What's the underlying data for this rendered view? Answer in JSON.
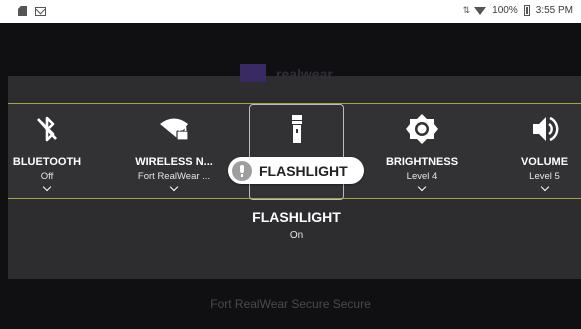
{
  "status_bar": {
    "battery_percent": "100%",
    "time": "3:55 PM",
    "left_icons": [
      "sd-card-icon",
      "mail-icon"
    ],
    "right_icons": [
      "data-arrows-icon",
      "wifi-icon",
      "battery-icon"
    ]
  },
  "background": {
    "logo_text": "realwear",
    "footer_text": "Fort RealWear Secure Secure"
  },
  "quick_settings": {
    "tiles": [
      {
        "icon": "bluetooth-off-icon",
        "label": "BLUETOOTH",
        "value": "Off"
      },
      {
        "icon": "wifi-locked-icon",
        "label": "WIRELESS N...",
        "value": "Fort RealWear ..."
      },
      {
        "icon": "flashlight-icon",
        "label": "FLASHLIGHT",
        "value": ""
      },
      {
        "icon": "brightness-icon",
        "label": "BRIGHTNESS",
        "value": "Level 4"
      },
      {
        "icon": "volume-icon",
        "label": "VOLUME",
        "value": "Level 5"
      }
    ],
    "selected": {
      "title": "FLASHLIGHT",
      "state": "On"
    }
  },
  "voice_command": {
    "icon": "mic-icon",
    "text": "FLASHLIGHT"
  },
  "colors": {
    "accent_border": "#9ea24a",
    "strip_background": "#323234",
    "panel_background": "#2d2d2f"
  }
}
